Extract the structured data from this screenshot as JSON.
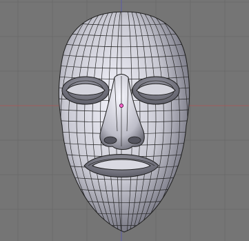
{
  "viewport": {
    "view": "front-orthographic",
    "background_color": "#757575",
    "grid_color": "#6a6a6a",
    "x_axis_color": "#a15a5a",
    "z_axis_color": "#5c5ca8",
    "grid_visible": true
  },
  "mesh": {
    "object": "face-mask",
    "display_mode": "solid-with-wireframe",
    "surface_color": "#c9c9d3",
    "shadow_color": "#5f5f6c",
    "highlight_color": "#f2f2fa",
    "wire_color": "#222222",
    "vertex_selected": true
  },
  "icons": {
    "origin": "object-origin-icon"
  }
}
